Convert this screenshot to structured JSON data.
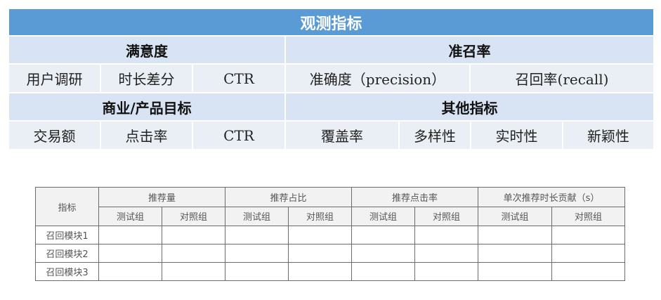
{
  "metrics": {
    "title": "观测指标",
    "satisfaction": {
      "label": "满意度",
      "items": [
        "用户调研",
        "时长差分",
        "CTR"
      ]
    },
    "recall_precision": {
      "label": "准召率",
      "items": [
        "准确度（precision）",
        "召回率(recall)"
      ]
    },
    "business": {
      "label": "商业/产品目标",
      "items": [
        "交易额",
        "点击率",
        "CTR"
      ]
    },
    "other": {
      "label": "其他指标",
      "items": [
        "覆盖率",
        "多样性",
        "实时性",
        "新颖性"
      ]
    }
  },
  "table": {
    "corner": "指标",
    "groups": [
      "推荐量",
      "推荐占比",
      "推荐点击率",
      "单次推荐时长贡献（s）"
    ],
    "sub_test": "测试组",
    "sub_control": "对照组",
    "rows": [
      "召回模块1",
      "召回模块2",
      "召回模块3"
    ]
  }
}
